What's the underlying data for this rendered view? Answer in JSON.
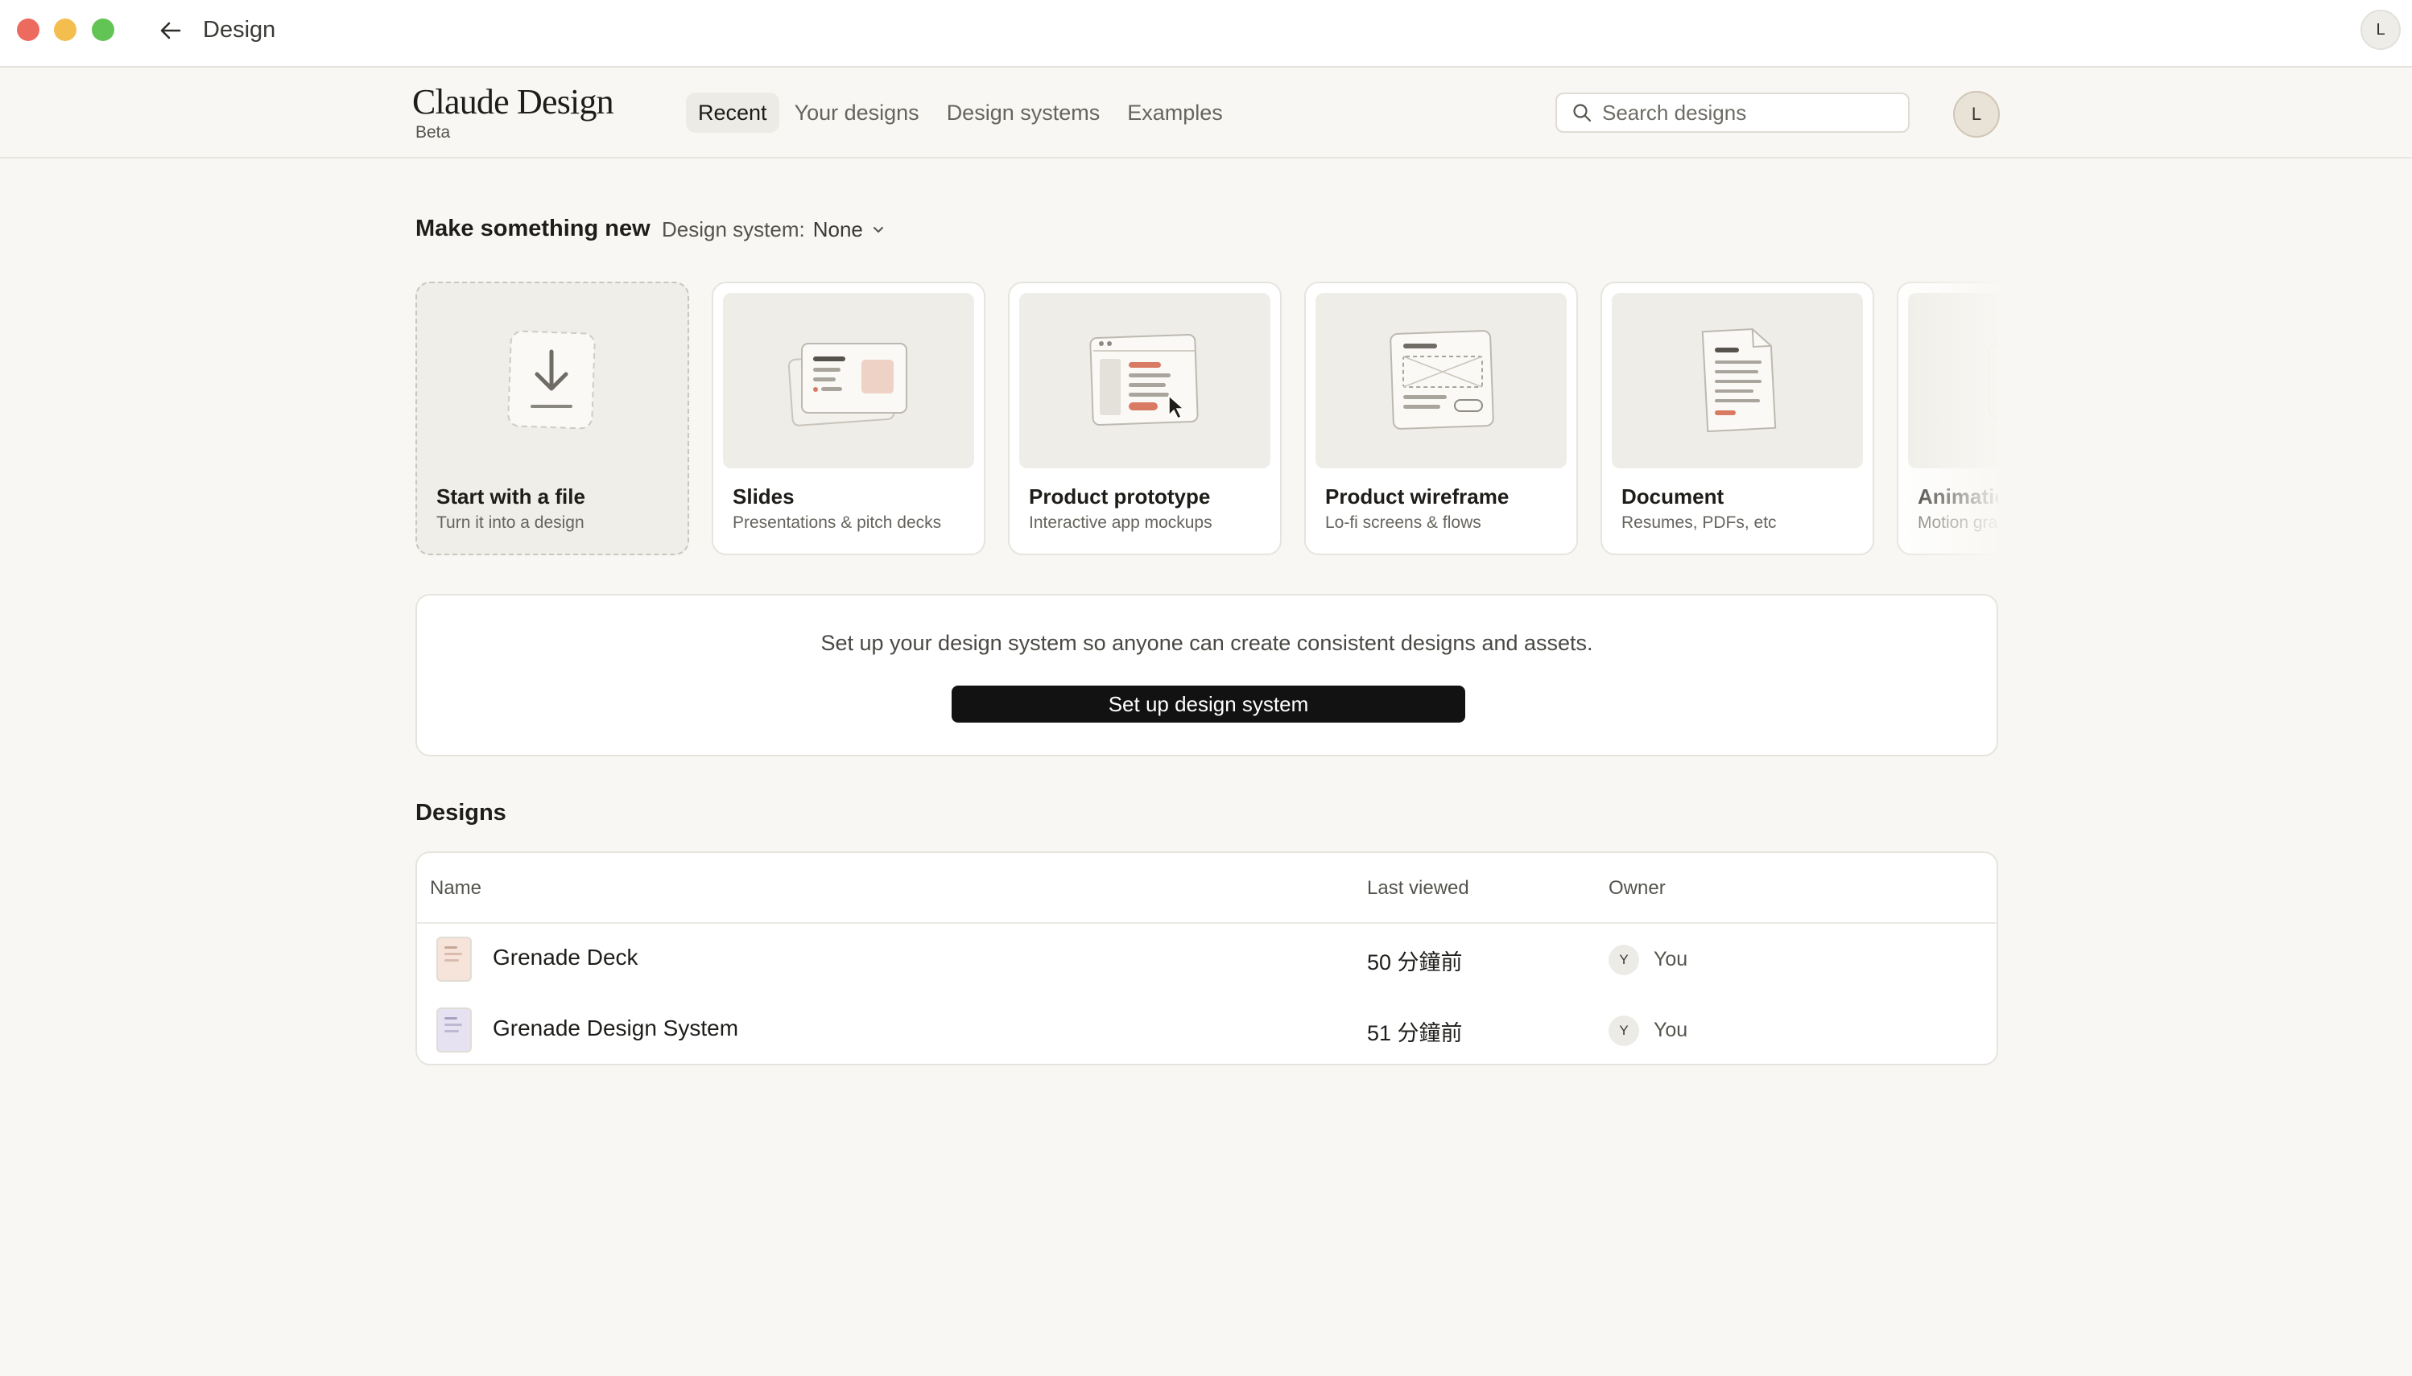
{
  "window": {
    "title": "Design",
    "avatar_initial": "L"
  },
  "header": {
    "brand": "Claude Design",
    "badge": "Beta",
    "tabs": [
      {
        "label": "Recent",
        "active": true
      },
      {
        "label": "Your designs",
        "active": false
      },
      {
        "label": "Design systems",
        "active": false
      },
      {
        "label": "Examples",
        "active": false
      }
    ],
    "search": {
      "placeholder": "Search designs",
      "value": ""
    },
    "user_initial": "L"
  },
  "make_new": {
    "title": "Make something new",
    "design_system_label": "Design system:",
    "design_system_value": "None",
    "cards": [
      {
        "title": "Start with a file",
        "subtitle": "Turn it into a design",
        "icon": "download-file-icon"
      },
      {
        "title": "Slides",
        "subtitle": "Presentations & pitch decks",
        "icon": "slides-icon"
      },
      {
        "title": "Product prototype",
        "subtitle": "Interactive app mockups",
        "icon": "prototype-icon"
      },
      {
        "title": "Product wireframe",
        "subtitle": "Lo-fi screens & flows",
        "icon": "wireframe-icon"
      },
      {
        "title": "Document",
        "subtitle": "Resumes, PDFs, etc",
        "icon": "document-icon"
      },
      {
        "title": "Animation",
        "subtitle": "Motion graphics",
        "icon": "animation-icon"
      }
    ]
  },
  "design_system_banner": {
    "text": "Set up your design system so anyone can create consistent designs and assets.",
    "button_label": "Set up design system"
  },
  "designs": {
    "title": "Designs",
    "columns": {
      "name": "Name",
      "last_viewed": "Last viewed",
      "owner": "Owner"
    },
    "rows": [
      {
        "name": "Grenade Deck",
        "last_viewed": "50 分鐘前",
        "owner_initial": "Y",
        "owner": "You",
        "thumb_color": "#f6e3da"
      },
      {
        "name": "Grenade Design System",
        "last_viewed": "51 分鐘前",
        "owner_initial": "Y",
        "owner": "You",
        "thumb_color": "#e7e2f2"
      }
    ]
  },
  "colors": {
    "background": "#f8f7f3",
    "accent_terracotta": "#d97a62",
    "button_dark": "#121212"
  }
}
